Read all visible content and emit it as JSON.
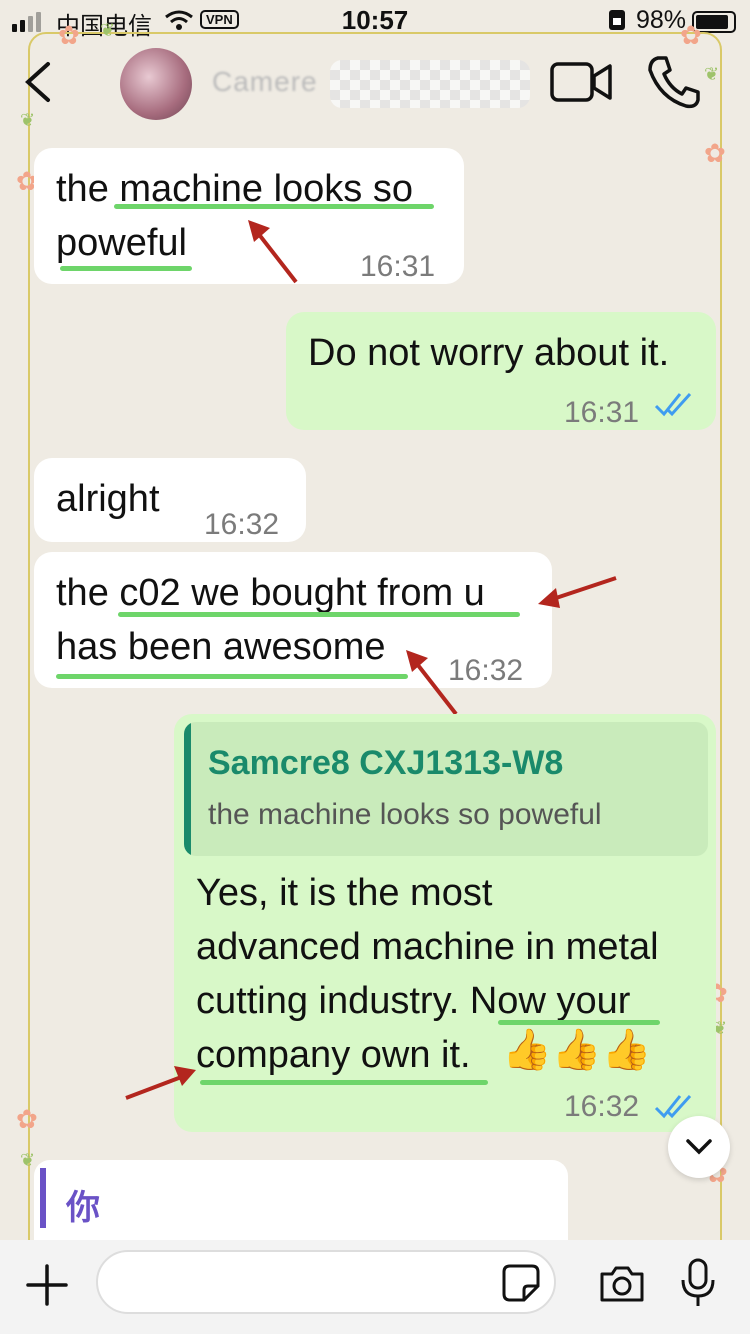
{
  "status_bar": {
    "carrier": "中国电信",
    "vpn": "VPN",
    "time": "10:57",
    "battery": "98%"
  },
  "header": {
    "contact_name": "Camere"
  },
  "messages": [
    {
      "direction": "in",
      "text_line1": "the machine looks so",
      "text_line2": "poweful",
      "time": "16:31"
    },
    {
      "direction": "out",
      "text": "Do not worry about it.",
      "time": "16:31"
    },
    {
      "direction": "in",
      "text": "alright",
      "time": "16:32"
    },
    {
      "direction": "in",
      "text_line1": "the c02 we bought from u",
      "text_line2": "has been awesome",
      "time": "16:32"
    },
    {
      "direction": "out",
      "quote_name": "Samcre8 CXJ1313-W8",
      "quote_text": "the machine looks so poweful",
      "line1": "Yes, it is the most",
      "line2": "advanced machine in metal",
      "line3": "cutting industry. Now your",
      "line4": "company own it.",
      "emoji": "👍👍👍",
      "time": "16:32"
    }
  ],
  "reply_preview": {
    "text": "你"
  },
  "input": {
    "placeholder": ""
  },
  "colors": {
    "incoming_bubble": "#ffffff",
    "outgoing_bubble": "#d8f8c8",
    "highlight_underline": "#6ed56a",
    "annotation_arrow": "#b3261e",
    "quote_accent": "#1a8a6b",
    "read_ticks": "#3f9cf0"
  }
}
